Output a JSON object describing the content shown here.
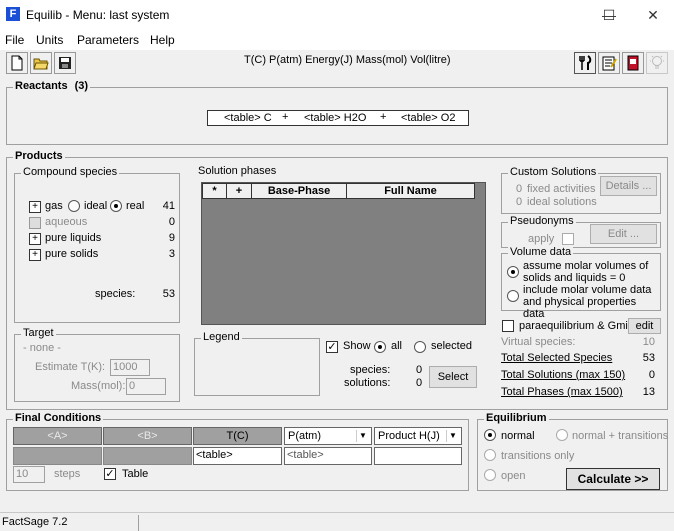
{
  "window": {
    "title": "Equilib - Menu: last system",
    "minimize": "—",
    "maximize": "☐",
    "close": "✕"
  },
  "menu": [
    "File",
    "Units",
    "Parameters",
    "Help"
  ],
  "toolbar": {
    "units_summary": "T(C)  P(atm)  Energy(J)  Mass(mol)  Vol(litre)"
  },
  "reactants": {
    "title": "Reactants",
    "count": "(3)",
    "items": [
      {
        "label": "<table> C",
        "sep": "+"
      },
      {
        "label": "<table> H2O",
        "sep": "+"
      },
      {
        "label": "<table> O2",
        "sep": ""
      }
    ]
  },
  "products": {
    "title": "Products",
    "compound_species": {
      "title": "Compound species",
      "gas_label": "gas",
      "ideal_label": "ideal",
      "real_label": "real",
      "gas_count": "41",
      "aqueous_label": "aqueous",
      "aqueous_count": "0",
      "pure_liquids_label": "pure liquids",
      "pure_liquids_count": "9",
      "pure_solids_label": "pure solids",
      "pure_solids_count": "3",
      "species_label": "species:",
      "species_count": "53",
      "plus": "+"
    },
    "target": {
      "title": "Target",
      "value": "- none -",
      "estimate_label": "Estimate T(K):",
      "estimate_value": "1000",
      "mass_label": "Mass(mol):",
      "mass_value": "0"
    },
    "solution_phases": {
      "title": "Solution phases",
      "columns": [
        "*",
        "+",
        "Base-Phase",
        "Full Name"
      ]
    },
    "legend": {
      "title": "Legend",
      "show_label": "Show",
      "all_label": "all",
      "selected_label": "selected",
      "species_label": "species:",
      "species_value": "0",
      "solutions_label": "solutions:",
      "solutions_value": "0",
      "select_button": "Select"
    },
    "custom_solutions": {
      "title": "Custom Solutions",
      "fixed_count": "0",
      "fixed_label": "fixed activities",
      "ideal_count": "0",
      "ideal_label": "ideal solutions",
      "details_button": "Details ..."
    },
    "pseudonyms": {
      "title": "Pseudonyms",
      "apply_label": "apply",
      "edit_button": "Edit ..."
    },
    "volume_data": {
      "title": "Volume data",
      "option1": "assume molar volumes of solids and liquids = 0",
      "option1_line1": "assume molar volumes of",
      "option1_line2": "solids and liquids = 0",
      "option2_line1": "include molar volume data",
      "option2_line2": "and physical properties data"
    },
    "paraequilibrium_label": "paraequilibrium & Gmin",
    "paraequilibrium_edit": "edit",
    "stats": [
      {
        "label": "Virtual species:",
        "value": "10",
        "link": false
      },
      {
        "label": "Total Selected Species",
        "value": "53",
        "link": true
      },
      {
        "label": "Total Solutions (max 150)",
        "value": "0",
        "link": true
      },
      {
        "label": "Total Phases (max 1500)",
        "value": "13",
        "link": true
      }
    ]
  },
  "final_conditions": {
    "title": "Final Conditions",
    "col_a": "<A>",
    "col_b": "<B>",
    "col_t": "T(C)",
    "col_p": "P(atm)",
    "col_h": "Product H(J)",
    "t_value": "<table>",
    "p_value": "<table>",
    "steps_value": "10",
    "steps_label": "steps",
    "table_label": "Table"
  },
  "equilibrium": {
    "title": "Equilibrium",
    "normal_label": "normal",
    "normal_transitions_label": "normal + transitions",
    "transitions_only_label": "transitions only",
    "open_label": "open",
    "calculate_button": "Calculate >>"
  },
  "status": {
    "text": "FactSage 7.2"
  }
}
